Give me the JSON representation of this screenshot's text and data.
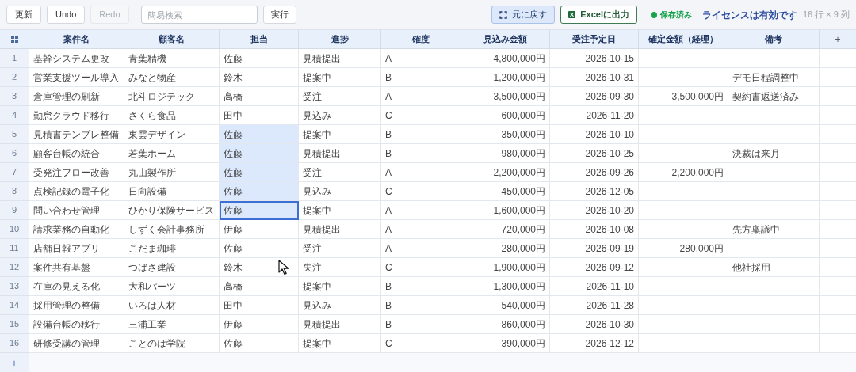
{
  "toolbar": {
    "left_buttons": [
      {
        "label": "更新",
        "disabled": false
      },
      {
        "label": "Undo",
        "disabled": false
      },
      {
        "label": "Redo",
        "disabled": true
      }
    ],
    "search": {
      "placeholder": "簡易検索"
    },
    "search_button": "実行",
    "restore_button": {
      "label": "元に戻す",
      "selected": true
    },
    "export_button": "Excelに出力",
    "save_status": {
      "label": "保存済み",
      "color": "#16a34a"
    },
    "license": "ライセンスは有効です",
    "size": "16 行 × 9 列"
  },
  "table": {
    "columns": [
      {
        "label": "案件名",
        "kind": "text",
        "selected": false
      },
      {
        "label": "顧客名",
        "kind": "text",
        "selected": false
      },
      {
        "label": "担当",
        "kind": "text",
        "selected": true
      },
      {
        "label": "進捗",
        "kind": "text",
        "selected": false
      },
      {
        "label": "確度",
        "kind": "text",
        "selected": false
      },
      {
        "label": "見込み金額",
        "kind": "amount",
        "selected": false
      },
      {
        "label": "受注予定日",
        "kind": "amount",
        "selected": false
      },
      {
        "label": "確定金額（経理）",
        "kind": "amount",
        "selected": false
      },
      {
        "label": "備考",
        "kind": "text",
        "selected": false
      }
    ],
    "add_column": "+",
    "rows": [
      {
        "num": "1",
        "cells": [
          "基幹システム更改",
          "青葉精機",
          "佐藤",
          "見積提出",
          "A",
          "4,800,000円",
          "2026-10-15",
          null,
          null
        ],
        "selected": false,
        "active": false
      },
      {
        "num": "2",
        "cells": [
          "営業支援ツール導入",
          "みなと物産",
          "鈴木",
          "提案中",
          "B",
          "1,200,000円",
          "2026-10-31",
          null,
          "デモ日程調整中"
        ],
        "selected": false,
        "active": false
      },
      {
        "num": "3",
        "cells": [
          "倉庫管理の刷新",
          "北斗ロジテック",
          "高橋",
          "受注",
          "A",
          "3,500,000円",
          "2026-09-30",
          "3,500,000円",
          "契約書返送済み"
        ],
        "selected": false,
        "active": false
      },
      {
        "num": "4",
        "cells": [
          "勤怠クラウド移行",
          "さくら食品",
          "田中",
          "見込み",
          "C",
          "600,000円",
          "2026-11-20",
          null,
          null
        ],
        "selected": false,
        "active": false
      },
      {
        "num": "5",
        "cells": [
          "見積書テンプレ整備",
          "東雲デザイン",
          "佐藤",
          "提案中",
          "B",
          "350,000円",
          "2026-10-10",
          null,
          null
        ],
        "selected": true,
        "active": false
      },
      {
        "num": "6",
        "cells": [
          "顧客台帳の統合",
          "若葉ホーム",
          "佐藤",
          "見積提出",
          "B",
          "980,000円",
          "2026-10-25",
          null,
          "決裁は来月"
        ],
        "selected": true,
        "active": false
      },
      {
        "num": "7",
        "cells": [
          "受発注フロー改善",
          "丸山製作所",
          "佐藤",
          "受注",
          "A",
          "2,200,000円",
          "2026-09-26",
          "2,200,000円",
          null
        ],
        "selected": true,
        "active": false
      },
      {
        "num": "8",
        "cells": [
          "点検記録の電子化",
          "日向設備",
          "佐藤",
          "見込み",
          "C",
          "450,000円",
          "2026-12-05",
          null,
          null
        ],
        "selected": true,
        "active": false
      },
      {
        "num": "9",
        "cells": [
          "問い合わせ管理",
          "ひかり保険サービス",
          "佐藤",
          "提案中",
          "A",
          "1,600,000円",
          "2026-10-20",
          null,
          null
        ],
        "selected": true,
        "active": true
      },
      {
        "num": "10",
        "cells": [
          "請求業務の自動化",
          "しずく会計事務所",
          "伊藤",
          "見積提出",
          "A",
          "720,000円",
          "2026-10-08",
          null,
          "先方稟議中"
        ],
        "selected": false,
        "active": false
      },
      {
        "num": "11",
        "cells": [
          "店舗日報アプリ",
          "こだま珈琲",
          "佐藤",
          "受注",
          "A",
          "280,000円",
          "2026-09-19",
          "280,000円",
          null
        ],
        "selected": false,
        "active": false
      },
      {
        "num": "12",
        "cells": [
          "案件共有基盤",
          "つばさ建設",
          "鈴木",
          "失注",
          "C",
          "1,900,000円",
          "2026-09-12",
          null,
          "他社採用"
        ],
        "selected": false,
        "active": false
      },
      {
        "num": "13",
        "cells": [
          "在庫の見える化",
          "大和パーツ",
          "高橋",
          "提案中",
          "B",
          "1,300,000円",
          "2026-11-10",
          null,
          null
        ],
        "selected": false,
        "active": false
      },
      {
        "num": "14",
        "cells": [
          "採用管理の整備",
          "いろは人材",
          "田中",
          "見込み",
          "B",
          "540,000円",
          "2026-11-28",
          null,
          null
        ],
        "selected": false,
        "active": false
      },
      {
        "num": "15",
        "cells": [
          "設備台帳の移行",
          "三浦工業",
          "伊藤",
          "見積提出",
          "B",
          "860,000円",
          "2026-10-30",
          null,
          null
        ],
        "selected": false,
        "active": false
      },
      {
        "num": "16",
        "cells": [
          "研修受講の管理",
          "ことのは学院",
          "佐藤",
          "提案中",
          "C",
          "390,000円",
          "2026-12-12",
          null,
          null
        ],
        "selected": false,
        "active": false
      }
    ],
    "add_row": "+"
  }
}
